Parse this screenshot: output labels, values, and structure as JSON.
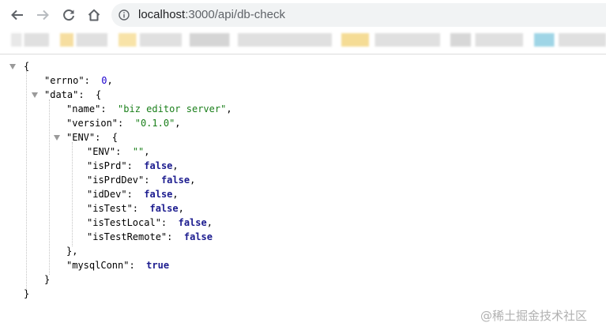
{
  "browser": {
    "url_host": "localhost",
    "url_rest": ":3000/api/db-check",
    "bookmark_colors": [
      "#e8e8e8",
      "#f6dea0",
      "#cfcfcf",
      "#f8e3a8",
      "#d5d5d5",
      "#f5dc95",
      "#d7d7d7",
      "#ececec",
      "#9fd5e6"
    ]
  },
  "json": {
    "open_brace": "{",
    "close_brace": "}",
    "errno_key": "\"errno\"",
    "errno_value": "0",
    "data_key": "\"data\"",
    "name_key": "\"name\"",
    "name_value": "\"biz editor server\"",
    "version_key": "\"version\"",
    "version_value": "\"0.1.0\"",
    "env_key": "\"ENV\"",
    "env_env_key": "\"ENV\"",
    "env_env_value": "\"\"",
    "isPrd_key": "\"isPrd\"",
    "isPrd_value": "false",
    "isPrdDev_key": "\"isPrdDev\"",
    "isPrdDev_value": "false",
    "idDev_key": "\"idDev\"",
    "idDev_value": "false",
    "isTest_key": "\"isTest\"",
    "isTest_value": "false",
    "isTestLocal_key": "\"isTestLocal\"",
    "isTestLocal_value": "false",
    "isTestRemote_key": "\"isTestRemote\"",
    "isTestRemote_value": "false",
    "env_close": "},",
    "mysqlConn_key": "\"mysqlConn\"",
    "mysqlConn_value": "true"
  },
  "watermark": "@稀土掘金技术社区"
}
